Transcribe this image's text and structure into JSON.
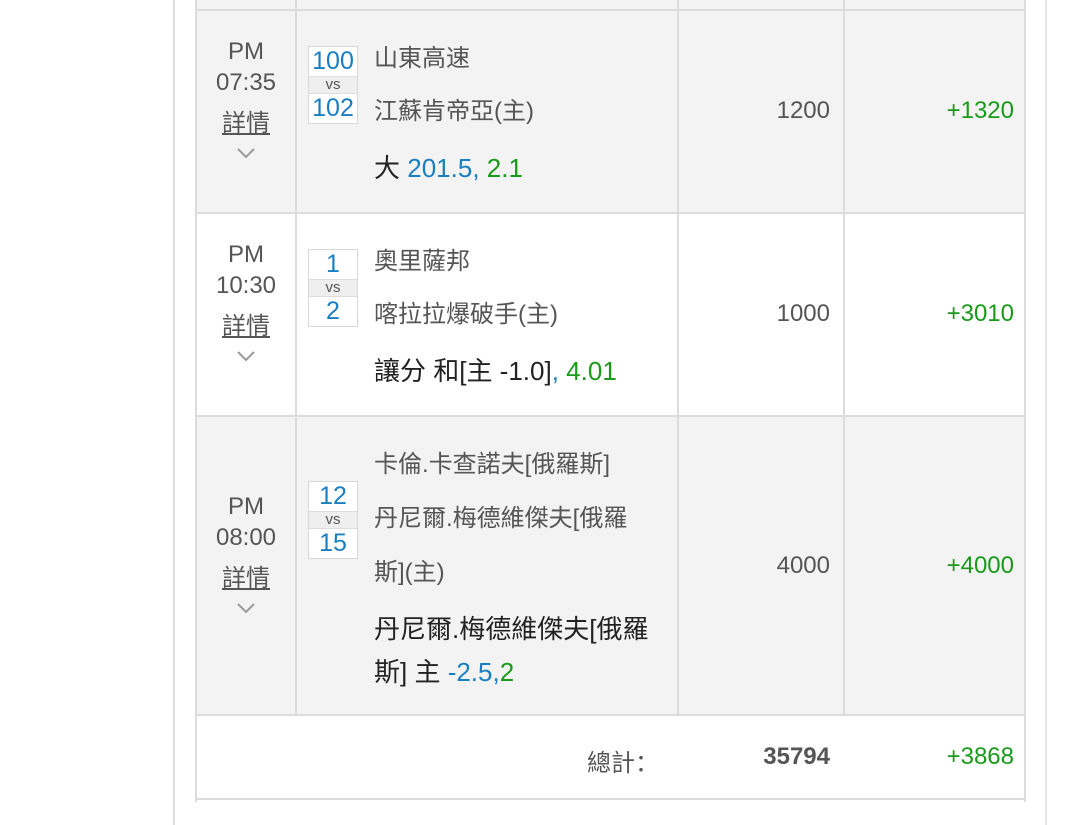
{
  "bets": [
    {
      "period": "PM",
      "time": "07:35",
      "details_label": "詳情",
      "score_away": "100",
      "vs_label": "vs",
      "score_home": "102",
      "team_away": "山東高速",
      "team_home": "江蘇肯帝亞(主)",
      "pick": "大",
      "pick_line": "201.5,",
      "pick_odds": "2.1",
      "amount": "1200",
      "result": "+1320"
    },
    {
      "period": "PM",
      "time": "10:30",
      "details_label": "詳情",
      "score_away": "1",
      "vs_label": "vs",
      "score_home": "2",
      "team_away": "奧里薩邦",
      "team_home": "喀拉拉爆破手(主)",
      "pick": "讓分 和[主 -1.0]",
      "pick_line": ",",
      "pick_odds": "4.01",
      "amount": "1000",
      "result": "+3010"
    },
    {
      "period": "PM",
      "time": "08:00",
      "details_label": "詳情",
      "score_away": "12",
      "vs_label": "vs",
      "score_home": "15",
      "team_away": "卡倫.卡查諾夫[俄羅斯]",
      "team_home_line1": "丹尼爾.梅德維傑夫[俄羅",
      "team_home_line2": "斯](主)",
      "pick_line1": "丹尼爾.梅德維傑夫[俄羅",
      "pick_line2": "斯] 主",
      "pick_line": "-2.5,",
      "pick_odds": "2",
      "amount": "4000",
      "result": "+4000"
    }
  ],
  "total": {
    "label": "總計：",
    "amount": "35794",
    "result": "+3868"
  },
  "colors": {
    "blue": "#1a7fc2",
    "green": "#1a9a1a",
    "gray_row": "#f3f3f3",
    "border": "#dcdcdc"
  },
  "icons": {
    "expand": "chevron-down-icon"
  }
}
